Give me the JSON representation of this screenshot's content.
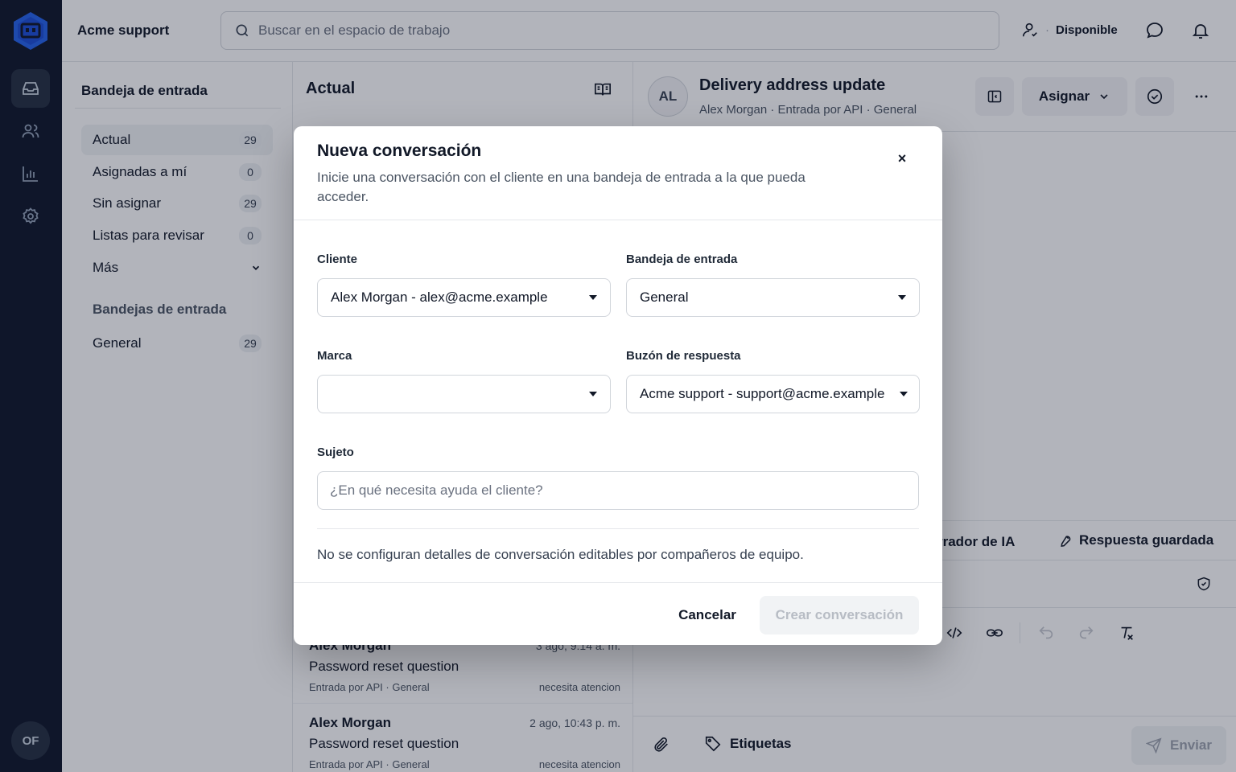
{
  "topbar": {
    "workspace": "Acme support",
    "search_placeholder": "Buscar en el espacio de trabajo",
    "status_label": "Disponible",
    "status_separator": "·"
  },
  "rail": {
    "user_initials": "OF"
  },
  "sidebar": {
    "title": "Bandeja de entrada",
    "items": [
      {
        "label": "Actual",
        "count": "29"
      },
      {
        "label": "Asignadas a mí",
        "count": "0"
      },
      {
        "label": "Sin asignar",
        "count": "29"
      },
      {
        "label": "Listas para revisar",
        "count": "0"
      },
      {
        "label": "Más"
      }
    ],
    "section_title": "Bandejas de entrada",
    "inboxes": [
      {
        "label": "General",
        "count": "29"
      }
    ]
  },
  "conversation_list": {
    "title": "Actual",
    "items": [
      {
        "name": "Alex Morgan",
        "time": "3 ago, 9:14 a. m.",
        "subject": "Password reset question",
        "meta": "Entrada por API · General",
        "state": "necesita atencion"
      },
      {
        "name": "Alex Morgan",
        "time": "2 ago, 10:43 p. m.",
        "subject": "Password reset question",
        "meta": "Entrada por API · General",
        "state": "necesita atencion"
      }
    ]
  },
  "detail": {
    "avatar_initials": "AL",
    "title": "Delivery address update",
    "subtitle": "Alex Morgan  ·  Entrada por API  ·  General",
    "assign_label": "Asignar",
    "ai_label": "rrador de IA",
    "saved_reply_label": "Respuesta guardada",
    "tags_label": "Etiquetas",
    "send_label": "Enviar"
  },
  "modal": {
    "title": "Nueva conversación",
    "description": "Inicie una conversación con el cliente en una bandeja de entrada a la que pueda acceder.",
    "close_glyph": "×",
    "customer_label": "Cliente",
    "customer_value": "Alex Morgan - alex@acme.example",
    "inbox_label": "Bandeja de entrada",
    "inbox_value": "General",
    "brand_label": "Marca",
    "brand_value": "",
    "mailbox_label": "Buzón de respuesta",
    "mailbox_value": "Acme support - support@acme.example",
    "subject_label": "Sujeto",
    "subject_placeholder": "¿En qué necesita ayuda el cliente?",
    "subject_value": "",
    "note": "No se configuran detalles de conversación editables por compañeros de equipo.",
    "cancel_label": "Cancelar",
    "create_label": "Crear conversación"
  },
  "colors": {
    "rail_bg": "#0f172a",
    "brand_logo": "#2563eb",
    "overlay": "rgba(15,23,42,0.32)"
  }
}
